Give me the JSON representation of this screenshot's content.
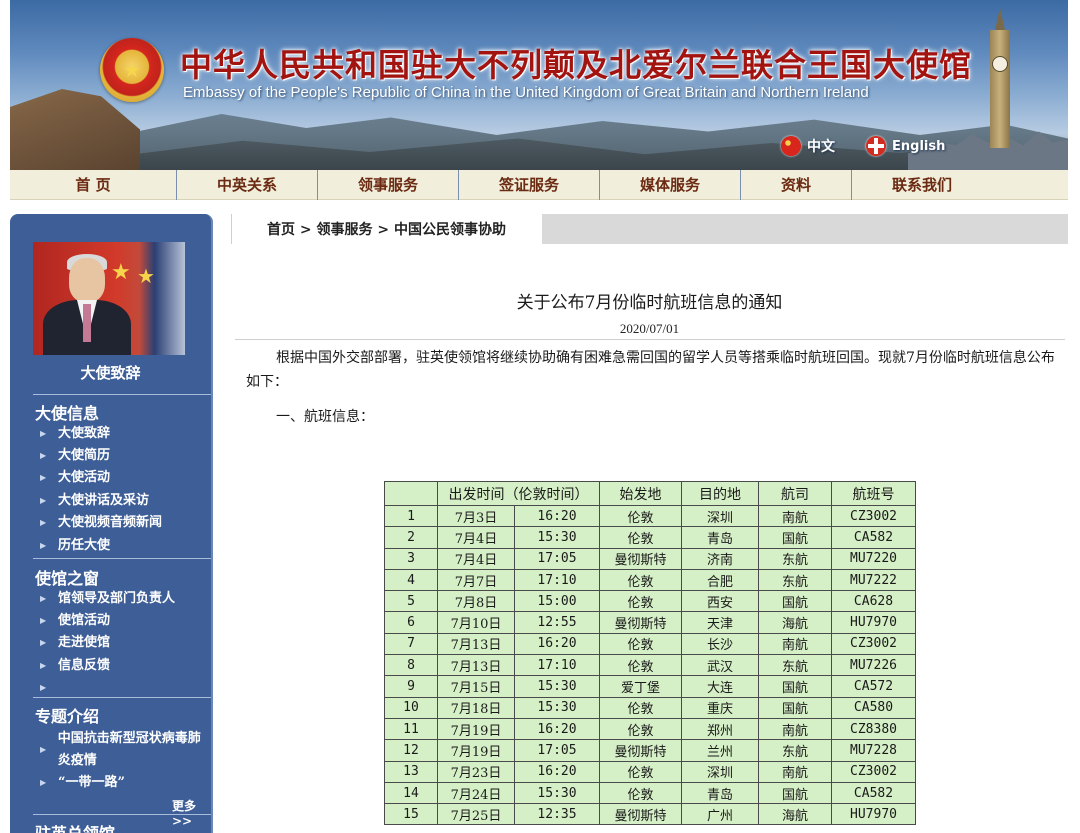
{
  "header": {
    "title_cn": "中华人民共和国驻大不列颠及北爱尔兰联合王国大使馆",
    "title_en": "Embassy of the People's Republic of China in the United Kingdom of Great Britain and Northern Ireland",
    "lang_cn": "中文",
    "lang_en": "English"
  },
  "nav": {
    "items": [
      "首 页",
      "中英关系",
      "领事服务",
      "签证服务",
      "媒体服务",
      "资料",
      "联系我们"
    ]
  },
  "sidebar": {
    "photo_caption": "大使致辞",
    "sections": [
      {
        "title": "大使信息",
        "links": [
          "大使致辞",
          "大使简历",
          "大使活动",
          "大使讲话及采访",
          "大使视频音频新闻",
          "历任大使"
        ]
      },
      {
        "title": "使馆之窗",
        "links": [
          "馆领导及部门负责人",
          "使馆活动",
          "走进使馆",
          "信息反馈",
          ""
        ]
      },
      {
        "title": "专题介绍",
        "links": [
          "中国抗击新型冠状病毒肺炎疫情",
          "“一带一路”"
        ]
      }
    ],
    "more": "更多>>",
    "next_section": "驻英总领馆"
  },
  "breadcrumb": {
    "home": "首页",
    "sep": " > ",
    "level2": "领事服务",
    "level3": "中国公民领事协助"
  },
  "article": {
    "title": "关于公布7月份临时航班信息的通知",
    "date": "2020/07/01",
    "body": "根据中国外交部部署，驻英使领馆将继续协助确有困难急需回国的留学人员等搭乘临时航班回国。现就7月份临时航班信息公布如下：",
    "section1": "一、航班信息："
  },
  "table": {
    "headers": [
      "",
      "出发时间（伦敦时间）",
      "始发地",
      "目的地",
      "航司",
      "航班号"
    ],
    "rows": [
      [
        "1",
        "7月3日",
        "16:20",
        "伦敦",
        "深圳",
        "南航",
        "CZ3002"
      ],
      [
        "2",
        "7月4日",
        "15:30",
        "伦敦",
        "青岛",
        "国航",
        "CA582"
      ],
      [
        "3",
        "7月4日",
        "17:05",
        "曼彻斯特",
        "济南",
        "东航",
        "MU7220"
      ],
      [
        "4",
        "7月7日",
        "17:10",
        "伦敦",
        "合肥",
        "东航",
        "MU7222"
      ],
      [
        "5",
        "7月8日",
        "15:00",
        "伦敦",
        "西安",
        "国航",
        "CA628"
      ],
      [
        "6",
        "7月10日",
        "12:55",
        "曼彻斯特",
        "天津",
        "海航",
        "HU7970"
      ],
      [
        "7",
        "7月13日",
        "16:20",
        "伦敦",
        "长沙",
        "南航",
        "CZ3002"
      ],
      [
        "8",
        "7月13日",
        "17:10",
        "伦敦",
        "武汉",
        "东航",
        "MU7226"
      ],
      [
        "9",
        "7月15日",
        "15:30",
        "爱丁堡",
        "大连",
        "国航",
        "CA572"
      ],
      [
        "10",
        "7月18日",
        "15:30",
        "伦敦",
        "重庆",
        "国航",
        "CA580"
      ],
      [
        "11",
        "7月19日",
        "16:20",
        "伦敦",
        "郑州",
        "南航",
        "CZ8380"
      ],
      [
        "12",
        "7月19日",
        "17:05",
        "曼彻斯特",
        "兰州",
        "东航",
        "MU7228"
      ],
      [
        "13",
        "7月23日",
        "16:20",
        "伦敦",
        "深圳",
        "南航",
        "CZ3002"
      ],
      [
        "14",
        "7月24日",
        "15:30",
        "伦敦",
        "青岛",
        "国航",
        "CA582"
      ],
      [
        "15",
        "7月25日",
        "12:35",
        "曼彻斯特",
        "广州",
        "海航",
        "HU7970"
      ]
    ]
  }
}
